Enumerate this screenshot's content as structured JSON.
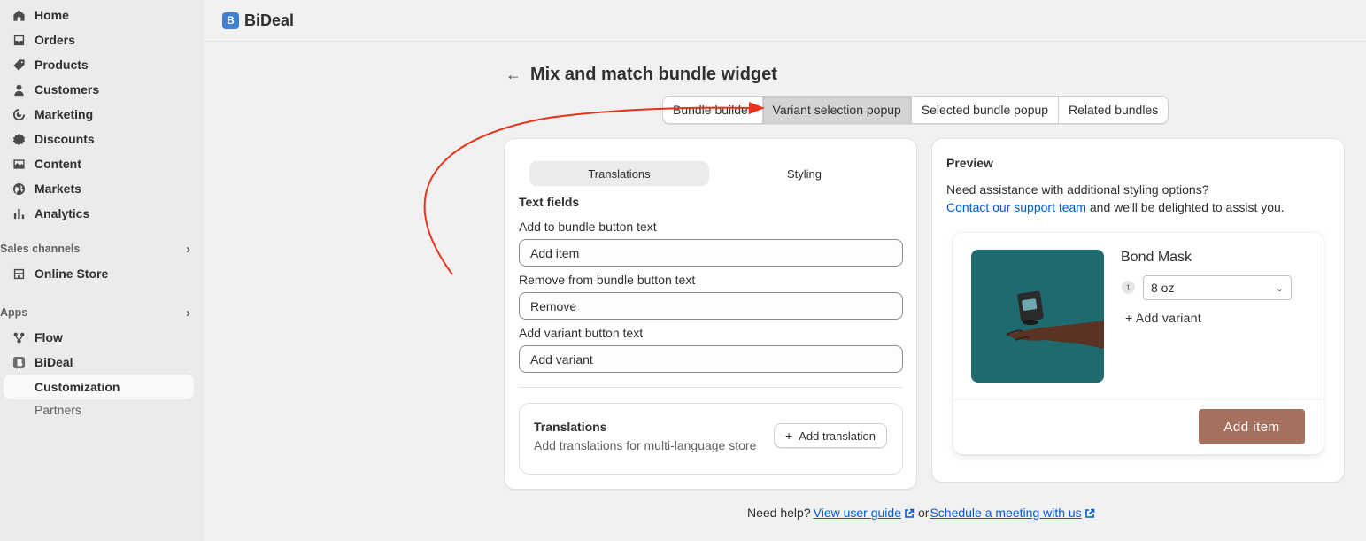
{
  "sidebar": {
    "items": [
      {
        "label": "Home",
        "icon": "home-icon"
      },
      {
        "label": "Orders",
        "icon": "inbox-icon"
      },
      {
        "label": "Products",
        "icon": "tag-icon"
      },
      {
        "label": "Customers",
        "icon": "person-icon"
      },
      {
        "label": "Marketing",
        "icon": "target-icon"
      },
      {
        "label": "Discounts",
        "icon": "discount-icon"
      },
      {
        "label": "Content",
        "icon": "image-icon"
      },
      {
        "label": "Markets",
        "icon": "globe-icon"
      },
      {
        "label": "Analytics",
        "icon": "bar-chart-icon"
      }
    ],
    "sales_channels": {
      "heading": "Sales channels",
      "items": [
        {
          "label": "Online Store"
        }
      ]
    },
    "apps": {
      "heading": "Apps",
      "items": [
        {
          "label": "Flow"
        },
        {
          "label": "BiDeal"
        }
      ],
      "sub_item": "Customization",
      "partners": "Partners"
    }
  },
  "topbar": {
    "app_name": "BiDeal",
    "logo_letter": "B"
  },
  "page": {
    "title": "Mix and match bundle widget"
  },
  "tabs": [
    "Bundle builder",
    "Variant selection popup",
    "Selected bundle popup",
    "Related bundles"
  ],
  "selected_tab": "Variant selection popup",
  "editor": {
    "segments": [
      "Translations",
      "Styling"
    ],
    "section_title": "Text fields",
    "fields": [
      {
        "label": "Add to bundle button text",
        "value": "Add item"
      },
      {
        "label": "Remove from bundle button text",
        "value": "Remove"
      },
      {
        "label": "Add variant button text",
        "value": "Add variant"
      }
    ],
    "translations": {
      "title": "Translations",
      "subtitle": "Add translations for multi-language store",
      "button": "Add translation"
    }
  },
  "preview": {
    "title": "Preview",
    "help_line1": "Need assistance with additional styling options?",
    "help_link": "Contact our support team",
    "help_line2": " and we'll be delighted to assist you.",
    "product": {
      "name": "Bond Mask",
      "qty": "1",
      "variant": "8 oz",
      "add_variant": "+ Add variant",
      "button": "Add item",
      "button_color": "#a6705f",
      "image_bg": "#1d6a6f"
    }
  },
  "footer": {
    "need_help": "Need help?",
    "guide": "View user guide",
    "or": "or",
    "meeting": "Schedule a meeting with us"
  }
}
